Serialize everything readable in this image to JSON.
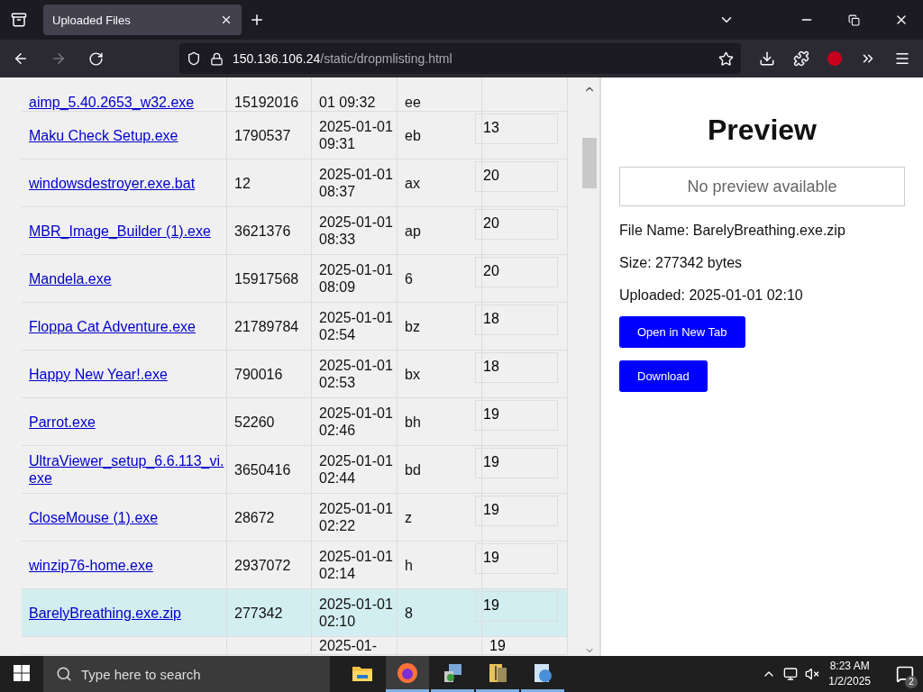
{
  "browser": {
    "tab_title": "Uploaded Files",
    "url_host": "150.136.106.24",
    "url_path": "/static/dropmlisting.html"
  },
  "table": {
    "rows": [
      {
        "kind": "top_cut",
        "name": "aimp_5.40.2653_w32.exe",
        "size": "15192016",
        "uploaded": "01 09:32",
        "column_4": "ee",
        "column_5": "",
        "selected": false
      },
      {
        "kind": "full",
        "name": "Maku Check Setup.exe",
        "size": "1790537",
        "uploaded": "2025-01-01 09:31",
        "column_4": "eb",
        "column_5": "13",
        "selected": false
      },
      {
        "kind": "full",
        "name": "windowsdestroyer.exe.bat",
        "size": "12",
        "uploaded": "2025-01-01 08:37",
        "column_4": "ax",
        "column_5": "20",
        "selected": false
      },
      {
        "kind": "full",
        "name": "MBR_Image_Builder (1).exe",
        "size": "3621376",
        "uploaded": "2025-01-01 08:33",
        "column_4": "ap",
        "column_5": "20",
        "selected": false
      },
      {
        "kind": "full",
        "name": "Mandela.exe",
        "size": "15917568",
        "uploaded": "2025-01-01 08:09",
        "column_4": "6",
        "column_5": "20",
        "selected": false
      },
      {
        "kind": "full",
        "name": "Floppa Cat Adventure.exe",
        "size": "21789784",
        "uploaded": "2025-01-01 02:54",
        "column_4": "bz",
        "column_5": "18",
        "selected": false
      },
      {
        "kind": "full",
        "name": "Happy New Year!.exe",
        "size": "790016",
        "uploaded": "2025-01-01 02:53",
        "column_4": "bx",
        "column_5": "18",
        "selected": false
      },
      {
        "kind": "full",
        "name": "Parrot.exe",
        "size": "52260",
        "uploaded": "2025-01-01 02:46",
        "column_4": "bh",
        "column_5": "19",
        "selected": false
      },
      {
        "kind": "full",
        "name": "UltraViewer_setup_6.6.113_vi.exe",
        "size": "3650416",
        "uploaded": "2025-01-01 02:44",
        "column_4": "bd",
        "column_5": "19",
        "selected": false
      },
      {
        "kind": "full",
        "name": "CloseMouse (1).exe",
        "size": "28672",
        "uploaded": "2025-01-01 02:22",
        "column_4": "z",
        "column_5": "19",
        "selected": false
      },
      {
        "kind": "full",
        "name": "winzip76-home.exe",
        "size": "2937072",
        "uploaded": "2025-01-01 02:14",
        "column_4": "h",
        "column_5": "19",
        "selected": false
      },
      {
        "kind": "full",
        "name": "BarelyBreathing.exe.zip",
        "size": "277342",
        "uploaded": "2025-01-01 02:10",
        "column_4": "8",
        "column_5": "19",
        "selected": true
      },
      {
        "kind": "bottom_cut",
        "name": "",
        "size": "",
        "uploaded": "2025-01-",
        "column_4": "",
        "column_5": "19",
        "selected": false
      }
    ]
  },
  "preview": {
    "title": "Preview",
    "placeholder": "No preview available",
    "file_name": "File Name: BarelyBreathing.exe.zip",
    "size": "Size: 277342 bytes",
    "uploaded": "Uploaded: 2025-01-01 02:10",
    "buttons": [
      "Open in New Tab",
      "Download"
    ]
  },
  "taskbar": {
    "search_placeholder": "Type here to search",
    "apps": [
      {
        "kind": "folder",
        "active": false,
        "running": false
      },
      {
        "kind": "firefox",
        "active": true,
        "running": true
      },
      {
        "kind": "installer",
        "active": false,
        "running": true
      },
      {
        "kind": "archive",
        "active": false,
        "running": true
      },
      {
        "kind": "globe",
        "active": false,
        "running": true
      }
    ],
    "time": "8:23 AM",
    "date": "1/2/2025",
    "notifications": "2"
  }
}
